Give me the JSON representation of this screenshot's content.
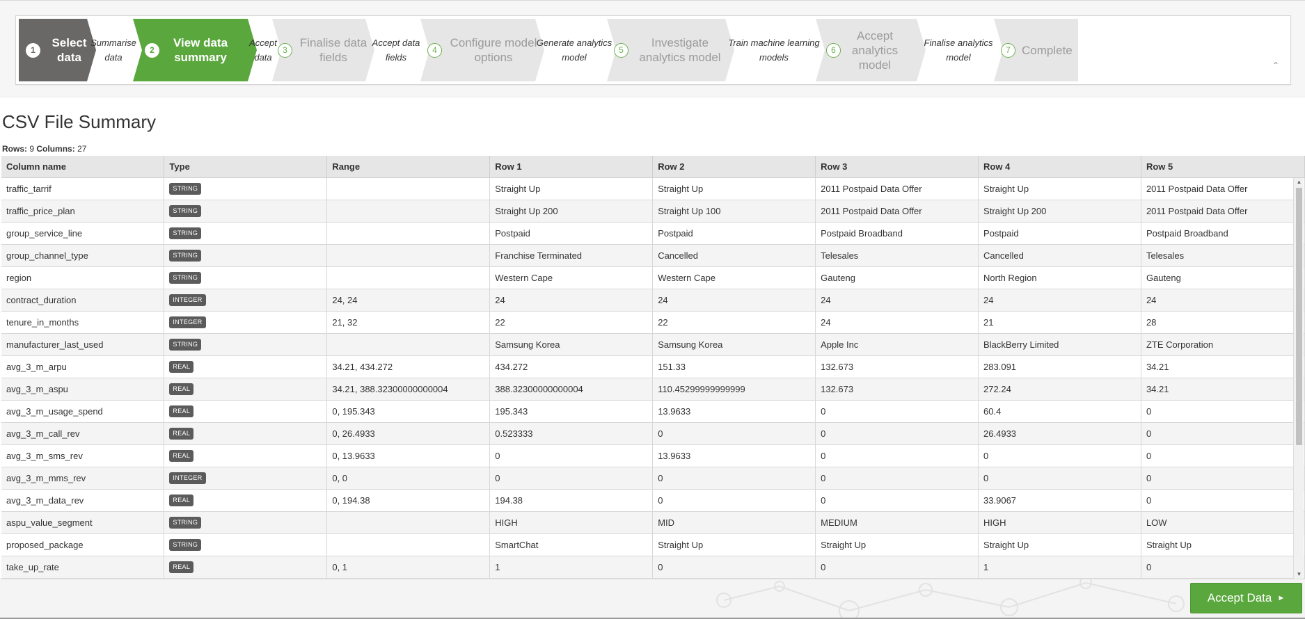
{
  "wizard": {
    "steps": [
      {
        "num": "1",
        "label": "Select data",
        "state": "completed"
      },
      {
        "num": "2",
        "label": "View data summary",
        "state": "active"
      },
      {
        "num": "3",
        "label": "Finalise data fields",
        "state": "pending"
      },
      {
        "num": "4",
        "label": "Configure model options",
        "state": "pending"
      },
      {
        "num": "5",
        "label": "Investigate analytics model",
        "state": "pending"
      },
      {
        "num": "6",
        "label": "Accept analytics model",
        "state": "pending"
      },
      {
        "num": "7",
        "label": "Complete",
        "state": "pending"
      }
    ],
    "substeps": [
      "Summarise data",
      "Accept data",
      "Accept data fields",
      "Generate analytics model",
      "Train machine learning models",
      "Finalise analytics model"
    ],
    "collapse_icon": "chevron-up-icon",
    "colors": {
      "completed": "#6a6867",
      "active": "#5aa83d",
      "pending": "#e6e6e6"
    }
  },
  "page": {
    "title": "CSV File Summary",
    "rows_label": "Rows:",
    "rows_value": "9",
    "columns_label": "Columns:",
    "columns_value": "27"
  },
  "table": {
    "headers": [
      "Column name",
      "Type",
      "Range",
      "Row 1",
      "Row 2",
      "Row 3",
      "Row 4",
      "Row 5"
    ],
    "rows": [
      [
        "traffic_tarrif",
        "STRING",
        "",
        "Straight Up",
        "Straight Up",
        "2011 Postpaid Data Offer",
        "Straight Up",
        "2011 Postpaid Data Offer"
      ],
      [
        "traffic_price_plan",
        "STRING",
        "",
        "Straight Up 200",
        "Straight Up 100",
        "2011 Postpaid Data Offer",
        "Straight Up 200",
        "2011 Postpaid Data Offer"
      ],
      [
        "group_service_line",
        "STRING",
        "",
        "Postpaid",
        "Postpaid",
        "Postpaid Broadband",
        "Postpaid",
        "Postpaid Broadband"
      ],
      [
        "group_channel_type",
        "STRING",
        "",
        "Franchise Terminated",
        "Cancelled",
        "Telesales",
        "Cancelled",
        "Telesales"
      ],
      [
        "region",
        "STRING",
        "",
        "Western Cape",
        "Western Cape",
        "Gauteng",
        "North Region",
        "Gauteng"
      ],
      [
        "contract_duration",
        "INTEGER",
        "24, 24",
        "24",
        "24",
        "24",
        "24",
        "24"
      ],
      [
        "tenure_in_months",
        "INTEGER",
        "21, 32",
        "22",
        "22",
        "24",
        "21",
        "28"
      ],
      [
        "manufacturer_last_used",
        "STRING",
        "",
        "Samsung Korea",
        "Samsung Korea",
        "Apple Inc",
        "BlackBerry Limited",
        "ZTE Corporation"
      ],
      [
        "avg_3_m_arpu",
        "REAL",
        "34.21, 434.272",
        "434.272",
        "151.33",
        "132.673",
        "283.091",
        "34.21"
      ],
      [
        "avg_3_m_aspu",
        "REAL",
        "34.21, 388.32300000000004",
        "388.32300000000004",
        "110.45299999999999",
        "132.673",
        "272.24",
        "34.21"
      ],
      [
        "avg_3_m_usage_spend",
        "REAL",
        "0, 195.343",
        "195.343",
        "13.9633",
        "0",
        "60.4",
        "0"
      ],
      [
        "avg_3_m_call_rev",
        "REAL",
        "0, 26.4933",
        "0.523333",
        "0",
        "0",
        "26.4933",
        "0"
      ],
      [
        "avg_3_m_sms_rev",
        "REAL",
        "0, 13.9633",
        "0",
        "13.9633",
        "0",
        "0",
        "0"
      ],
      [
        "avg_3_m_mms_rev",
        "INTEGER",
        "0, 0",
        "0",
        "0",
        "0",
        "0",
        "0"
      ],
      [
        "avg_3_m_data_rev",
        "REAL",
        "0, 194.38",
        "194.38",
        "0",
        "0",
        "33.9067",
        "0"
      ],
      [
        "aspu_value_segment",
        "STRING",
        "",
        "HIGH",
        "MID",
        "MEDIUM",
        "HIGH",
        "LOW"
      ],
      [
        "proposed_package",
        "STRING",
        "",
        "SmartChat",
        "Straight Up",
        "Straight Up",
        "Straight Up",
        "Straight Up"
      ],
      [
        "take_up_rate",
        "REAL",
        "0, 1",
        "1",
        "0",
        "0",
        "1",
        "0"
      ]
    ]
  },
  "footer": {
    "accept_label": "Accept Data",
    "accept_icon": "caret-right-icon",
    "accent": "#5aa83d"
  }
}
